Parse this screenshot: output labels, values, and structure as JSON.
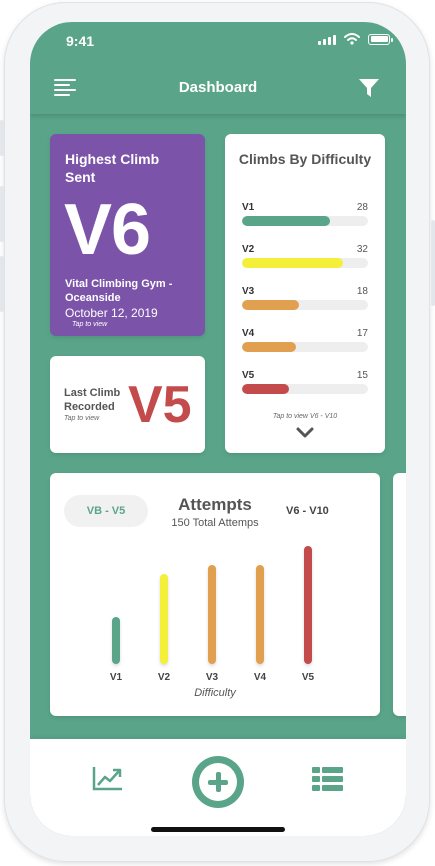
{
  "status_bar": {
    "time": "9:41"
  },
  "header": {
    "title": "Dashboard"
  },
  "highest": {
    "label": "Highest Climb Sent",
    "grade": "V6",
    "gym": "Vital Climbing Gym - Oceanside",
    "date": "October 12, 2019",
    "hint": "Tap to view"
  },
  "last": {
    "label": "Last Climb Recorded",
    "hint": "Tap to view",
    "grade": "V5"
  },
  "difficulty": {
    "title": "Climbs By Difficulty",
    "hint": "Tap to view V6 - V10",
    "max": 40,
    "rows": [
      {
        "grade": "V1",
        "count": "28",
        "value": 28,
        "color": "#5aa58a"
      },
      {
        "grade": "V2",
        "count": "32",
        "value": 32,
        "color": "#f4f03a"
      },
      {
        "grade": "V3",
        "count": "18",
        "value": 18,
        "color": "#e1a04f"
      },
      {
        "grade": "V4",
        "count": "17",
        "value": 17,
        "color": "#e1a04f"
      },
      {
        "grade": "V5",
        "count": "15",
        "value": 15,
        "color": "#c34b4b"
      }
    ]
  },
  "attempts": {
    "toggle_active": "VB - V5",
    "toggle_other": "V6 - V10",
    "title": "Attempts",
    "subtitle": "150 Total Attemps"
  },
  "chart_data": {
    "type": "bar",
    "title": "Attempts",
    "subtitle": "150 Total Attemps",
    "xlabel": "Difficulty",
    "ylabel": "",
    "categories": [
      "V1",
      "V2",
      "V3",
      "V4",
      "V5"
    ],
    "values": [
      10,
      19,
      21,
      21,
      25
    ],
    "colors": [
      "#5aa58a",
      "#f4f03a",
      "#e1a04f",
      "#e1a04f",
      "#c34b4b"
    ],
    "ylim": [
      0,
      25
    ],
    "grid": false
  },
  "bottom_nav": {
    "items": [
      "trend-chart-icon",
      "add-circle-icon",
      "list-icon"
    ]
  }
}
